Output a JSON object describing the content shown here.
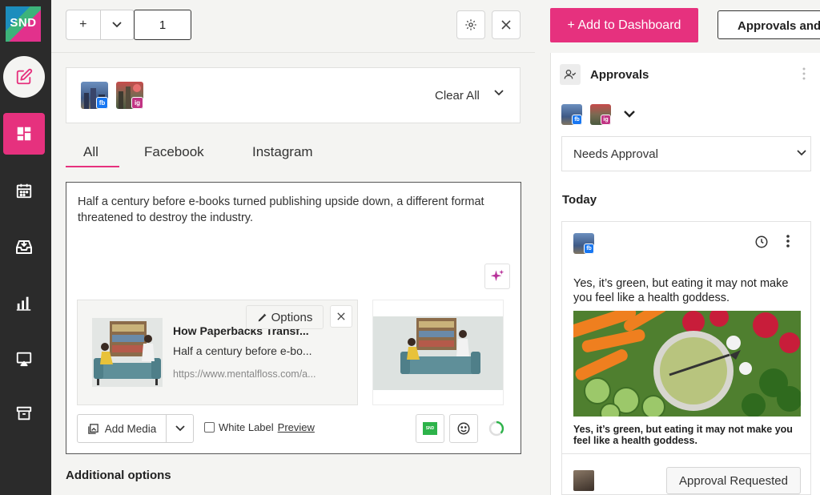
{
  "app": {
    "logo_text": "SND"
  },
  "nav": {
    "items": [
      "compose-icon",
      "dashboard-icon",
      "calendar-icon",
      "inbox-icon",
      "analytics-icon",
      "screen-icon",
      "archive-icon"
    ],
    "accent": "#e6317e"
  },
  "composer": {
    "toolbar": {
      "plus": "+",
      "count_value": "1"
    },
    "profiles": {
      "clear_all": "Clear All",
      "badges": [
        "fb",
        "ig"
      ]
    },
    "tabs": [
      "All",
      "Facebook",
      "Instagram"
    ],
    "active_tab": "All",
    "text": "Half a century before e-books turned publishing upside down, a different format threatened to destroy the industry.",
    "link": {
      "title": "How Paperbacks Transf...",
      "description": "Half a century before e-bo...",
      "url": "https://www.mentalfloss.com/a...",
      "options_label": "Options"
    },
    "footer": {
      "add_media": "Add Media",
      "white_label": "White Label",
      "preview": "Preview",
      "snd_badge": "SND"
    },
    "additional_options": "Additional options"
  },
  "right": {
    "add_dashboard": "+ Add to Dashboard",
    "approvals_button": "Approvals and",
    "panel_title": "Approvals",
    "filter": {
      "selected": "Needs Approval"
    },
    "profile_badges": [
      "fb",
      "ig"
    ],
    "section": "Today",
    "post": {
      "badge": "fb",
      "text": "Yes, it’s green, but eating it may not make you feel like a health goddess.",
      "caption": "Yes, it’s green, but eating it may not make you feel like a health goddess.",
      "status": "Approval Requested"
    }
  }
}
